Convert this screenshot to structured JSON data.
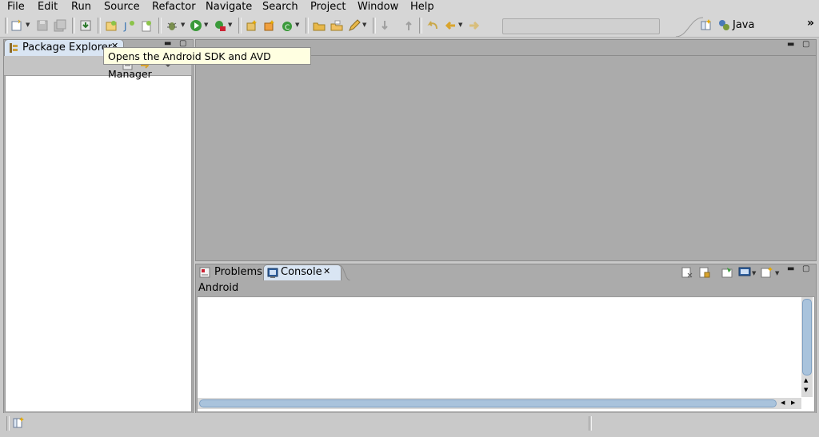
{
  "menu": {
    "items": [
      "File",
      "Edit",
      "Run",
      "Source",
      "Refactor",
      "Navigate",
      "Search",
      "Project",
      "Window",
      "Help"
    ]
  },
  "toolbar": {
    "icons": [
      "new-icon",
      "save-icon",
      "save-all-icon",
      "download-icon",
      "new-android-project-icon",
      "new-java-class-icon",
      "new-android-xml-icon",
      "debug-icon",
      "run-icon",
      "external-tools-icon",
      "new-java-package-icon",
      "new-class-icon",
      "open-type-icon",
      "open-folder-icon",
      "open-task-icon",
      "pencil-icon",
      "next-annotation-icon",
      "previous-annotation-icon",
      "last-edit-icon",
      "back-icon",
      "forward-icon"
    ],
    "overflow_label": "»"
  },
  "perspective": {
    "label": "Java"
  },
  "package_explorer": {
    "tab_label": "Package Explorer",
    "close_glyph": "✕"
  },
  "tooltip": {
    "text": "Opens the Android SDK and AVD Manager"
  },
  "bottom_panel": {
    "tabs": [
      {
        "label": "Problems",
        "icon": "problems-icon"
      },
      {
        "label": "Console",
        "icon": "console-icon"
      }
    ],
    "close_glyph": "✕",
    "console_title": "Android"
  },
  "colors": {
    "accent": "#d9e5f3",
    "tooltip_bg": "#ffffe1",
    "panel_gray": "#ababab"
  }
}
